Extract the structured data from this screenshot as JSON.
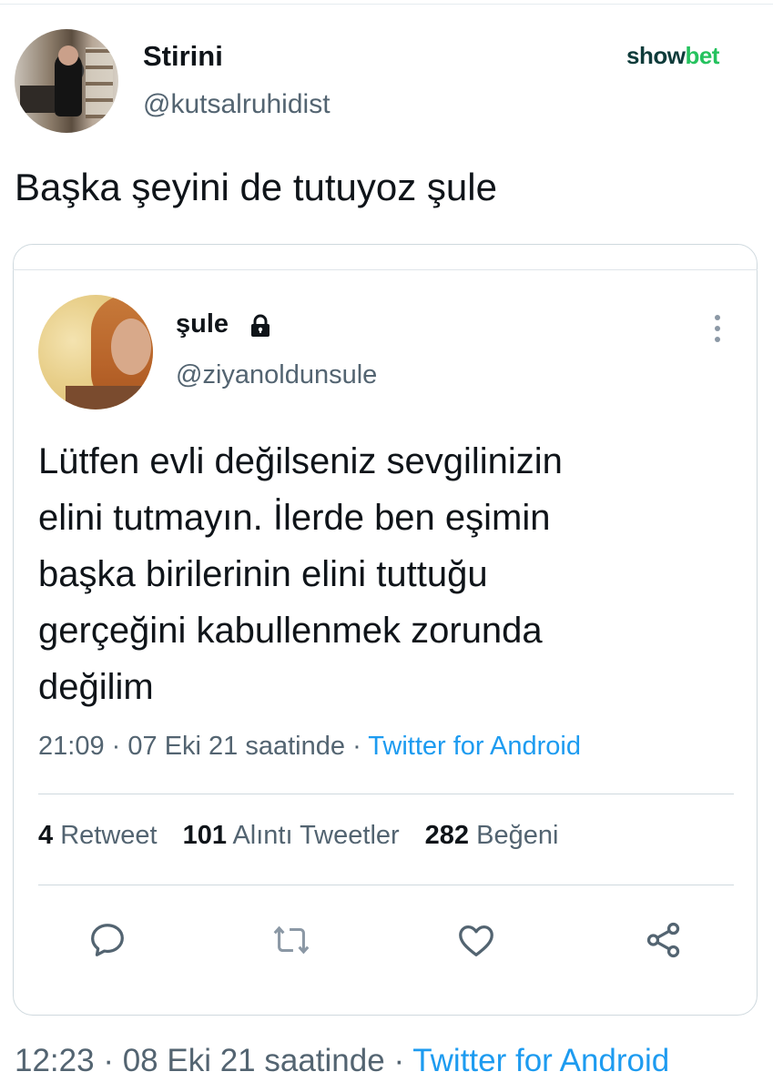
{
  "outer_tweet": {
    "name": "Stirini",
    "handle": "@kutsalruhidist",
    "text": "Başka şeyini de tutuyoz şule",
    "time": "12:23",
    "date": "08 Eki 21 saatinde",
    "separator": "·",
    "source": "Twitter for Android"
  },
  "watermark": {
    "part1": "show",
    "part2": "bet"
  },
  "quoted_tweet": {
    "name": "şule",
    "handle": "@ziyanoldunsule",
    "text": "Lütfen evli değilseniz sevgilinizin\nelini tutmayın. İlerde ben eşimin\nbaşka birilerinin elini tuttuğu\ngerçeğini kabullenmek zorunda\ndeğilim",
    "time": "21:09",
    "date": "07 Eki 21 saatinde",
    "separator": "·",
    "source": "Twitter for Android",
    "stats": {
      "retweets_count": "4",
      "retweets_label": "Retweet",
      "quotes_count": "101",
      "quotes_label": "Alıntı Tweetler",
      "likes_count": "282",
      "likes_label": "Beğeni"
    }
  },
  "icons": {
    "lock": "lock-icon",
    "more": "more-vertical-icon",
    "reply": "reply-icon",
    "retweet": "retweet-icon",
    "like": "like-icon",
    "share": "share-icon"
  },
  "colors": {
    "link": "#1d9bf0",
    "secondary": "#536471",
    "primary": "#0f1419",
    "brand_dark": "#0e3b3a",
    "brand_green": "#25c25e"
  }
}
